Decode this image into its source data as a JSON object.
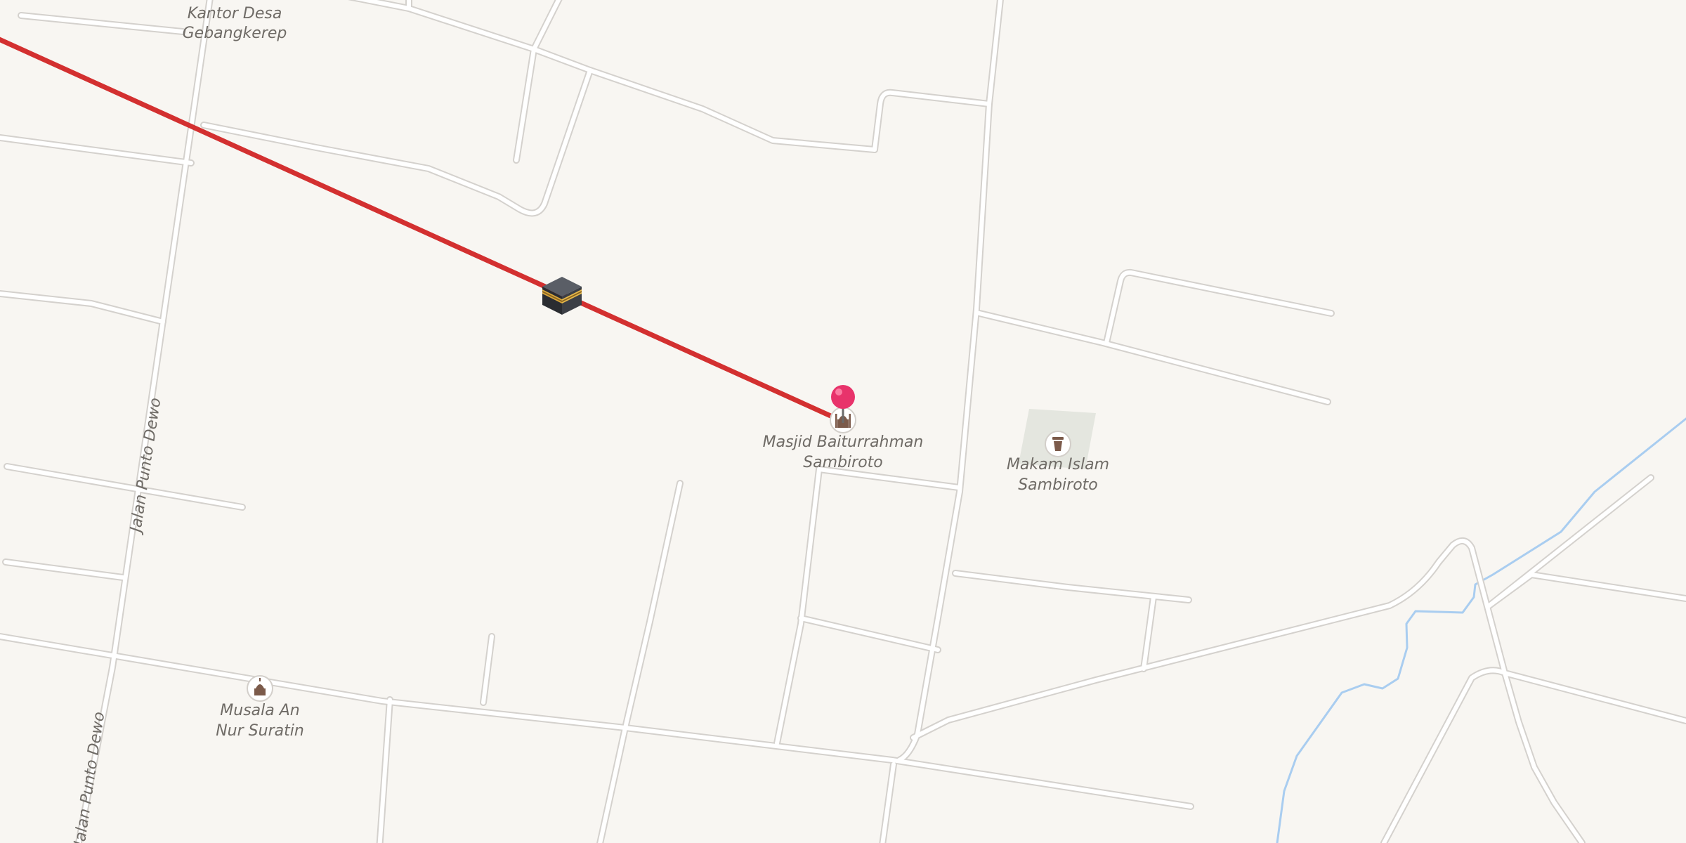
{
  "map": {
    "labels": {
      "kantor_desa": [
        "Kantor Desa",
        "Gebangkerep"
      ],
      "masjid": [
        "Masjid Baiturrahman",
        "Sambiroto"
      ],
      "makam": [
        "Makam Islam",
        "Sambiroto"
      ],
      "musala": [
        "Musala An",
        "Nur Suratin"
      ]
    },
    "streets": {
      "jalan_punto_dewo_upper": "Jalan Punto Dewo",
      "jalan_punto_dewo_lower": "Jalan Punto Dewo"
    },
    "icons": {
      "kaaba": "kaaba-icon",
      "location_pin": "map-pin-icon",
      "mosque": "mosque-icon",
      "cemetery": "cemetery-icon"
    },
    "colors": {
      "background": "#f8f6f2",
      "road": "#ffffff",
      "qibla_line": "#d33030",
      "water": "#a9cdf0",
      "pin": "#e8336b"
    }
  }
}
